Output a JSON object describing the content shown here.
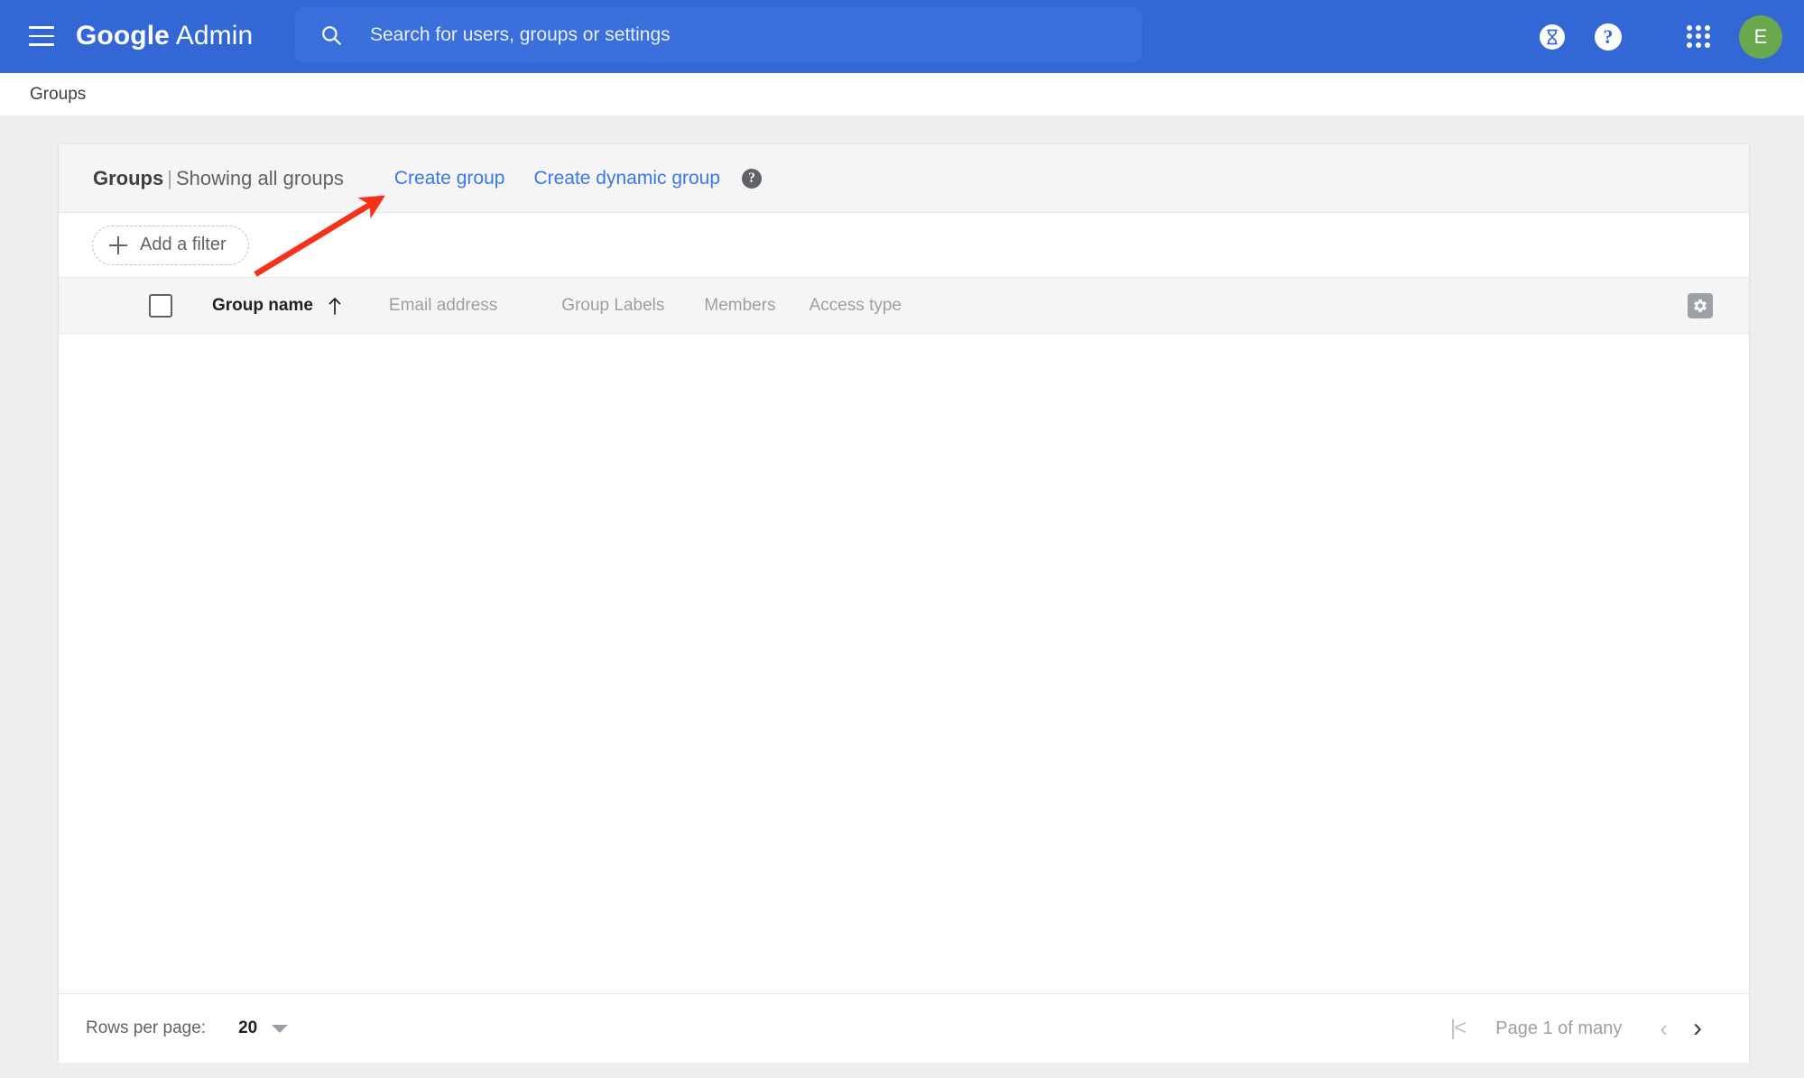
{
  "header": {
    "menu_icon": "hamburger-menu-icon",
    "brand_bold": "Google",
    "brand_light": " Admin",
    "search": {
      "icon": "search-icon",
      "placeholder": "Search for users, groups or settings",
      "value": ""
    },
    "actions": [
      {
        "name": "trial-hourglass-icon",
        "label": ""
      },
      {
        "name": "help-icon",
        "label": "?"
      },
      {
        "name": "apps-grid-icon",
        "label": ""
      }
    ],
    "avatar_letter": "E",
    "avatar_color": "#6aa84f",
    "bar_color": "#3367d6"
  },
  "breadcrumb": {
    "items": [
      "Groups"
    ]
  },
  "card": {
    "title_main": "Groups",
    "title_separator": "|",
    "title_sub": "Showing all groups",
    "links": [
      {
        "label": "Create group",
        "name": "create-group-link"
      },
      {
        "label": "Create dynamic group",
        "name": "create-dynamic-group-link"
      }
    ],
    "help_badge": "?",
    "link_color": "#3b78e7"
  },
  "filter": {
    "add_filter_label": "Add a filter",
    "plus_icon": "plus-icon"
  },
  "table": {
    "select_all_checked": false,
    "columns": [
      {
        "label": "Group name",
        "sorted": true,
        "sort_direction": "asc"
      },
      {
        "label": "Email address",
        "sorted": false
      },
      {
        "label": "Group Labels",
        "sorted": false
      },
      {
        "label": "Members",
        "sorted": false
      },
      {
        "label": "Access type",
        "sorted": false
      }
    ],
    "settings_icon": "gear-icon",
    "rows": []
  },
  "footer": {
    "rows_per_page_label": "Rows per page:",
    "rows_per_page_value": "20",
    "page_status": "Page 1 of many",
    "first_page_icon": "first-page-icon",
    "prev_page_icon": "chevron-left-icon",
    "next_page_icon": "chevron-right-icon"
  },
  "annotation": {
    "color": "#f4321c",
    "type": "arrow",
    "points_to": "Create group"
  }
}
